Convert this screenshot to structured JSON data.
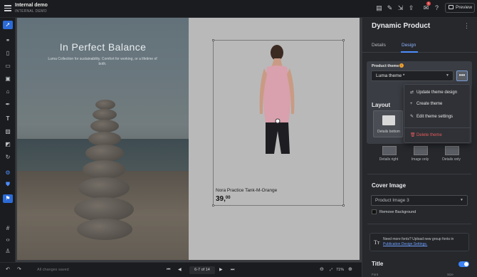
{
  "app": {
    "title": "Internal demo",
    "subtitle": "INTERNAL DEMO",
    "preview_label": "Preview",
    "notification_count": "1"
  },
  "canvas": {
    "hero_title": "In Perfect Balance",
    "hero_subtitle": "Luma Collection for sustainability. Comfort for working, or a lifetime of both.",
    "product_name": "Nora Practice Tank-M-Orange",
    "product_price_main": "39,",
    "product_price_cents": "00"
  },
  "bottombar": {
    "status": "All changes saved",
    "pager": "6-7 of 14",
    "zoom": "71%"
  },
  "panel": {
    "title": "Dynamic Product",
    "tabs": [
      {
        "label": "Details"
      },
      {
        "label": "Design"
      }
    ],
    "product_theme_label": "Product theme",
    "theme_value": "Luma theme *",
    "more_label": "•••",
    "layout_title": "Layout",
    "layouts": [
      {
        "label": "Details bottom"
      },
      {
        "label": "Details right"
      },
      {
        "label": "Image only"
      },
      {
        "label": "Details only"
      }
    ],
    "theme_menu": [
      {
        "label": "Update theme design",
        "icon": "swap-icon"
      },
      {
        "label": "Create theme",
        "icon": "plus-icon"
      },
      {
        "label": "Edit theme settings",
        "icon": "pencil-icon"
      },
      {
        "label": "Delete theme",
        "icon": "trash-icon"
      }
    ],
    "cover_title": "Cover Image",
    "cover_value": "Product Image 3",
    "remove_bg_label": "Remove Background",
    "fonts_text": "Need more fonts? Upload new group fonts in",
    "fonts_link": "Publication Design Settings.",
    "title_section": "Title",
    "font_label": "Font",
    "size_label": "Size"
  },
  "colors": {
    "accent": "#4d8cff",
    "danger": "#e25a5a",
    "panel_bg": "#26282c"
  }
}
